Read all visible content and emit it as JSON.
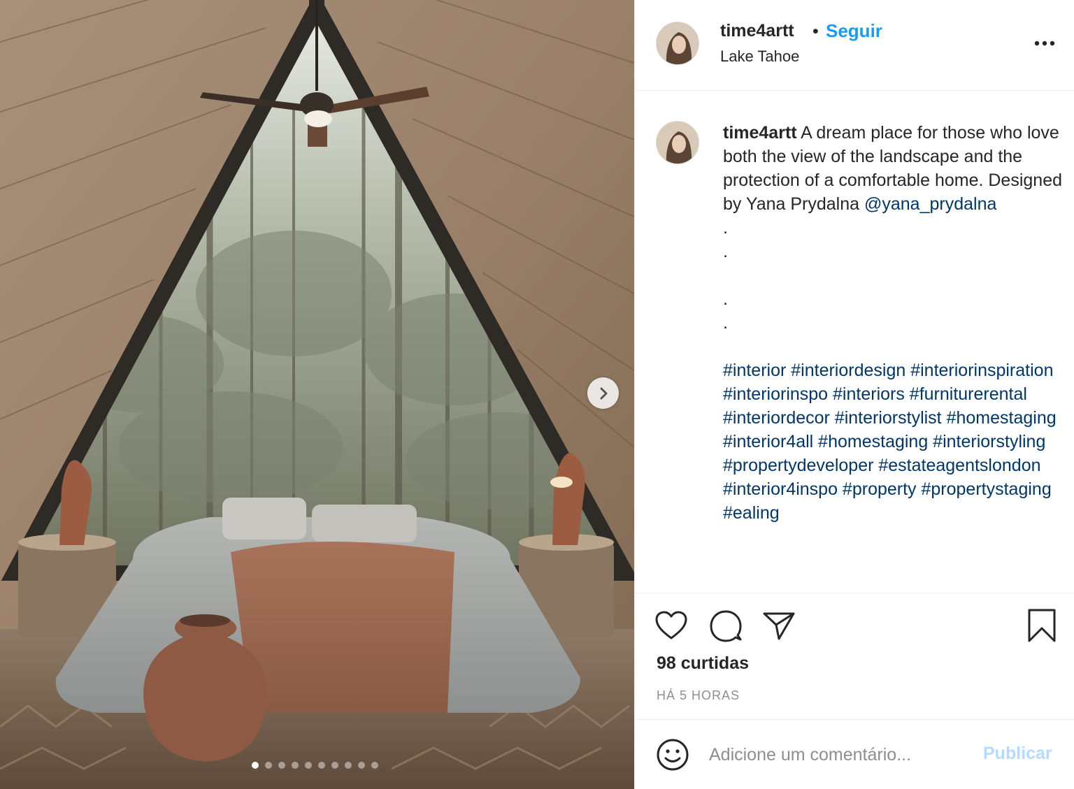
{
  "post": {
    "carousel": {
      "slide_count": 10,
      "active_index": 0,
      "next_icon": "chevron-right-icon"
    },
    "header": {
      "username": "time4artt",
      "separator": "•",
      "follow_label": "Seguir",
      "location": "Lake Tahoe",
      "more_icon": "more-options-icon"
    },
    "caption": {
      "username": "time4artt",
      "text": " A dream place for those who love both the view of the landscape and the protection of a comfortable home. Designed by Yana Prydalna ",
      "mention": "@yana_prydalna",
      "dots": "\n.\n.\n\n.\n.\n\n",
      "hashtags": "#interior #interiordesign #interiorinspiration #interiorinspo #interiors #furniturerental #interiordecor #interiorstylist #homestaging #interior4all #homestaging #interiorstyling #propertydeveloper #estateagentslondon #interior4inspo #property #propertystaging #ealing"
    },
    "actions": {
      "like_icon": "heart-icon",
      "comment_icon": "comment-icon",
      "share_icon": "share-icon",
      "save_icon": "bookmark-icon"
    },
    "likes_label": "98 curtidas",
    "time_label": "HÁ 5 HORAS",
    "comment": {
      "emoji_icon": "emoji-icon",
      "placeholder": "Adicione um comentário...",
      "publish_label": "Publicar"
    },
    "colors": {
      "accent": "#1a9bf3",
      "link": "#00376b",
      "publish_disabled": "#b3dbff",
      "muted": "#8e8e8e"
    }
  }
}
